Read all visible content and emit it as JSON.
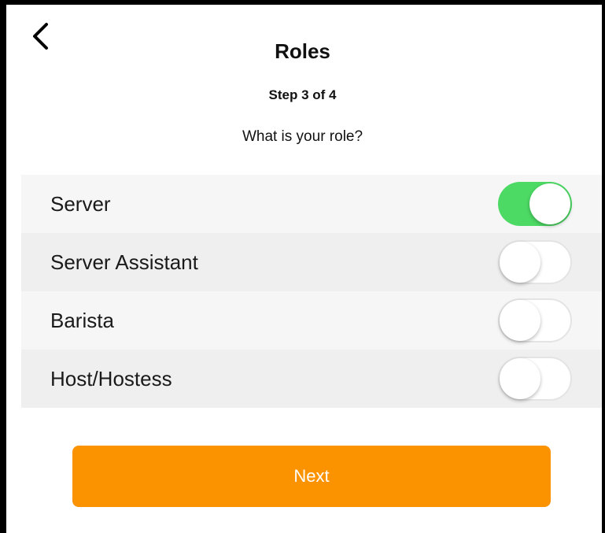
{
  "header": {
    "back_icon": "chevron-left-icon",
    "title": "Roles",
    "step_text": "Step 3 of 4",
    "question": "What is your role?"
  },
  "roles": [
    {
      "label": "Server",
      "enabled": true
    },
    {
      "label": "Server Assistant",
      "enabled": false
    },
    {
      "label": "Barista",
      "enabled": false
    },
    {
      "label": "Host/Hostess",
      "enabled": false
    }
  ],
  "footer": {
    "next_label": "Next"
  },
  "colors": {
    "toggle_on": "#4cd964",
    "button": "#fb9200",
    "row_light": "#f6f6f6",
    "row_dark": "#efefef"
  }
}
